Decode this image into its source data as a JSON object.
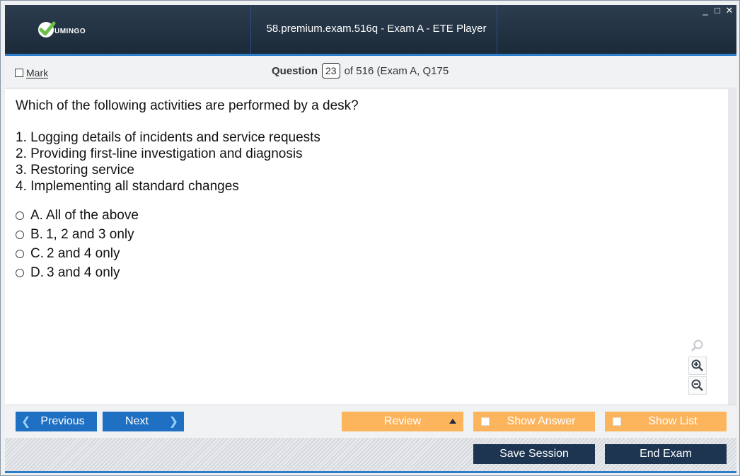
{
  "window": {
    "title": "58.premium.exam.516q - Exam A - ETE Player",
    "logo_text": "UMINGO",
    "controls": [
      "_",
      "□",
      "✕"
    ]
  },
  "header": {
    "mark_label": "Mark",
    "question_label": "Question",
    "question_number": "23",
    "question_of": "of 516 (Exam A, Q175"
  },
  "question": {
    "text": "Which of the following activities are performed by a desk?",
    "items": [
      "1. Logging details of incidents and service requests",
      "2. Providing first-line investigation and diagnosis",
      "3. Restoring service",
      "4. Implementing all standard changes"
    ],
    "options": [
      {
        "letter": "A.",
        "text": "All of the above"
      },
      {
        "letter": "B.",
        "text": "1, 2 and 3 only"
      },
      {
        "letter": "C.",
        "text": "2 and 4 only"
      },
      {
        "letter": "D.",
        "text": "3 and 4 only"
      }
    ]
  },
  "nav": {
    "previous": "Previous",
    "next": "Next",
    "review": "Review",
    "show_answer": "Show Answer",
    "show_list": "Show List",
    "save_session": "Save Session",
    "end_exam": "End Exam"
  },
  "colors": {
    "titlebar": "#1b2a39",
    "accent_blue": "#1f6fc2",
    "orange": "#fdb55d",
    "dark_button": "#1d3550",
    "logo_green": "#6cc04a"
  }
}
